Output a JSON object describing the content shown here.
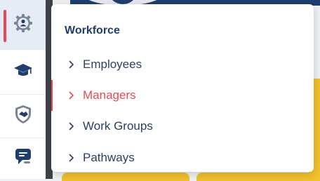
{
  "flyout": {
    "title": "Workforce",
    "items": [
      {
        "label": "Employees",
        "active": false
      },
      {
        "label": "Managers",
        "active": true
      },
      {
        "label": "Work Groups",
        "active": false
      },
      {
        "label": "Pathways",
        "active": false
      }
    ]
  },
  "rail": {
    "items": [
      {
        "icon": "workforce-gear-person-icon",
        "active": true
      },
      {
        "icon": "graduation-cap-icon",
        "active": false
      },
      {
        "icon": "shield-handshake-icon",
        "active": false
      },
      {
        "icon": "chat-message-icon",
        "active": false
      }
    ]
  },
  "colors": {
    "brand_navy": "#1f3d6e",
    "active_red": "#e24c57",
    "accent_yellow": "#f2c12e",
    "icon_gray": "#7b8494"
  }
}
